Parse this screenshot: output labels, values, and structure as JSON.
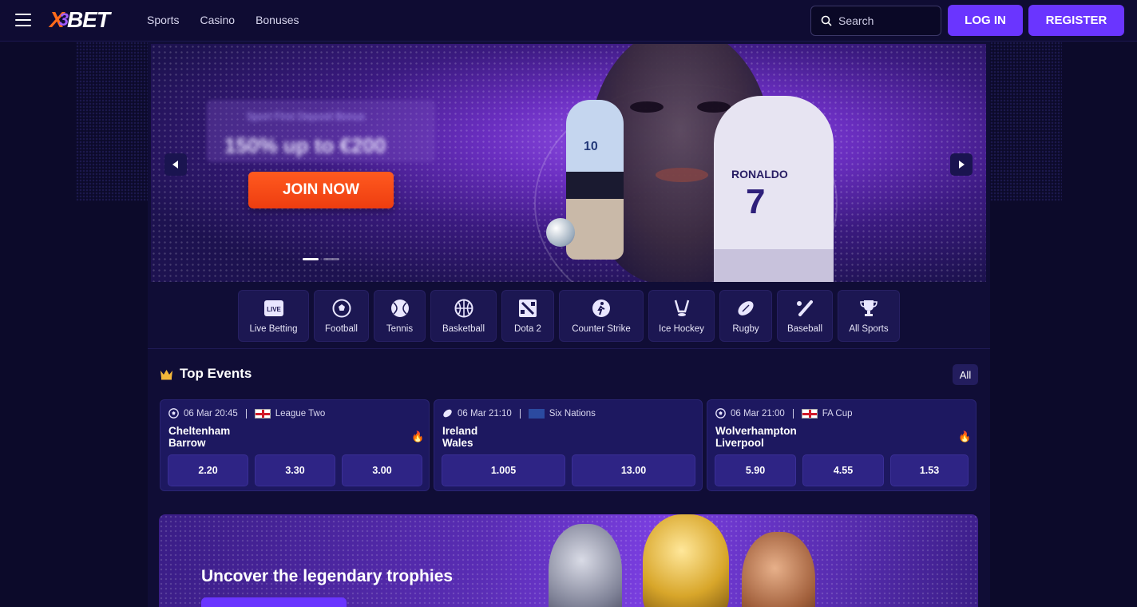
{
  "header": {
    "logo": {
      "x": "X",
      "three": "3",
      "bet": "BET"
    },
    "nav": [
      "Sports",
      "Casino",
      "Bonuses"
    ],
    "search_placeholder": "Search",
    "login_label": "LOG IN",
    "register_label": "REGISTER"
  },
  "banner": {
    "promo_subtitle": "Sport First Deposit Bonus",
    "promo_title": "150% up to €200",
    "join_label": "JOIN NOW",
    "slides_count": 2,
    "active_slide": 1,
    "player1_number": "10",
    "player2_name": "RONALDO",
    "player2_number": "7"
  },
  "sports": [
    {
      "label": "Live Betting",
      "icon": "live-icon"
    },
    {
      "label": "Football",
      "icon": "football-icon"
    },
    {
      "label": "Tennis",
      "icon": "tennis-icon"
    },
    {
      "label": "Basketball",
      "icon": "basketball-icon"
    },
    {
      "label": "Dota 2",
      "icon": "dota2-icon"
    },
    {
      "label": "Counter Strike",
      "icon": "counter-strike-icon"
    },
    {
      "label": "Ice Hockey",
      "icon": "ice-hockey-icon"
    },
    {
      "label": "Rugby",
      "icon": "rugby-icon"
    },
    {
      "label": "Baseball",
      "icon": "baseball-icon"
    },
    {
      "label": "All Sports",
      "icon": "trophy-icon"
    }
  ],
  "top_events": {
    "title": "Top Events",
    "all_label": "All",
    "events": [
      {
        "date": "06 Mar 20:45",
        "league": "League Two",
        "flag": "england",
        "sport_icon": "football-icon",
        "team1": "Cheltenham",
        "team2": "Barrow",
        "hot": true,
        "odds": [
          "2.20",
          "3.30",
          "3.00"
        ]
      },
      {
        "date": "06 Mar 21:10",
        "league": "Six Nations",
        "flag": "europe",
        "sport_icon": "rugby-icon",
        "team1": "Ireland",
        "team2": "Wales",
        "hot": false,
        "odds": [
          "1.005",
          "13.00"
        ]
      },
      {
        "date": "06 Mar 21:00",
        "league": "FA Cup",
        "flag": "england",
        "sport_icon": "football-icon",
        "team1": "Wolverhampton",
        "team2": "Liverpool",
        "hot": true,
        "odds": [
          "5.90",
          "4.55",
          "1.53"
        ]
      }
    ]
  },
  "trophy_banner": {
    "title": "Uncover the legendary trophies"
  },
  "colors": {
    "accent": "#6a35ff",
    "join": "#ff5a1f",
    "background": "#0c0a2a"
  }
}
